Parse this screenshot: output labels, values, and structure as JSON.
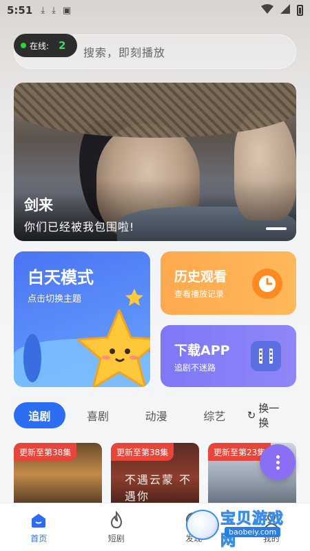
{
  "status_bar": {
    "time": "5:51"
  },
  "online": {
    "label": "在线:",
    "count": "2"
  },
  "search": {
    "placeholder": "搜索，即刻播放"
  },
  "banner": {
    "title": "剑来",
    "subtitle": "你们已经被我包围啦!"
  },
  "features": {
    "day_mode": {
      "title": "白天模式",
      "subtitle": "点击切换主题"
    },
    "history": {
      "title": "历史观看",
      "subtitle": "查看播放记录"
    },
    "download": {
      "title": "下载APP",
      "subtitle": "追剧不迷路"
    }
  },
  "tabs": [
    {
      "label": "追剧",
      "active": true
    },
    {
      "label": "喜剧",
      "active": false
    },
    {
      "label": "动漫",
      "active": false
    },
    {
      "label": "综艺",
      "active": false
    }
  ],
  "refresh_label": "换一换",
  "posters": [
    {
      "badge": "更新至第38集"
    },
    {
      "badge": "更新至第38集",
      "overlay": "不遇云蒙 不遇你"
    },
    {
      "badge": "更新至第23集"
    }
  ],
  "bottom_nav": [
    {
      "label": "首页",
      "active": true
    },
    {
      "label": "短剧",
      "active": false
    },
    {
      "label": "发现",
      "active": false
    },
    {
      "label": "我的",
      "active": false
    }
  ],
  "watermark": {
    "text": "宝贝游戏网",
    "url": "baobeiy.com"
  },
  "colors": {
    "accent": "#2b6ef2",
    "history": "#ffa94d",
    "download": "#7e78f6",
    "badge": "#e8463a",
    "online_dot": "#29d43a"
  }
}
